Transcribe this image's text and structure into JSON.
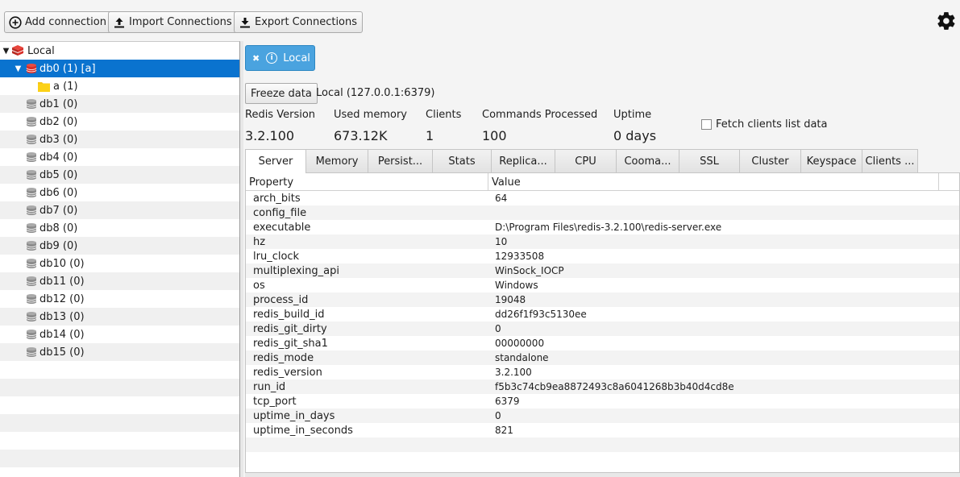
{
  "toolbar": {
    "add_connection": "Add connection",
    "import_connections": "Import Connections",
    "export_connections": "Export Connections"
  },
  "tree": {
    "root": "Local",
    "databases": [
      {
        "label": "db0 (1) [a]",
        "expanded": true,
        "selected": true
      },
      {
        "label": "db1 (0)"
      },
      {
        "label": "db2 (0)"
      },
      {
        "label": "db3 (0)"
      },
      {
        "label": "db4 (0)"
      },
      {
        "label": "db5 (0)"
      },
      {
        "label": "db6 (0)"
      },
      {
        "label": "db7 (0)"
      },
      {
        "label": "db8 (0)"
      },
      {
        "label": "db9 (0)"
      },
      {
        "label": "db10 (0)"
      },
      {
        "label": "db11 (0)"
      },
      {
        "label": "db12 (0)"
      },
      {
        "label": "db13 (0)"
      },
      {
        "label": "db14 (0)"
      },
      {
        "label": "db15 (0)"
      }
    ],
    "child_key": "a (1)"
  },
  "info_tab": {
    "label": "Local"
  },
  "freeze_button": "Freeze data",
  "connection": "Local (127.0.0.1:6379)",
  "stats": {
    "redis_version_label": "Redis Version",
    "redis_version": "3.2.100",
    "used_memory_label": "Used memory",
    "used_memory": "673.12K",
    "clients_label": "Clients",
    "clients": "1",
    "commands_label": "Commands Processed",
    "commands": "100",
    "uptime_label": "Uptime",
    "uptime": "0 days"
  },
  "fetch_clients": "Fetch clients list data",
  "tabs": [
    "Server",
    "Memory",
    "Persist...",
    "Stats",
    "Replica...",
    "CPU",
    "Cooma...",
    "SSL",
    "Cluster",
    "Keyspace",
    "Clients ..."
  ],
  "table": {
    "headers": [
      "Property",
      "Value"
    ],
    "rows": [
      [
        "arch_bits",
        "64"
      ],
      [
        "config_file",
        ""
      ],
      [
        "executable",
        "D:\\Program Files\\redis-3.2.100\\redis-server.exe"
      ],
      [
        "hz",
        "10"
      ],
      [
        "lru_clock",
        "12933508"
      ],
      [
        "multiplexing_api",
        "WinSock_IOCP"
      ],
      [
        "os",
        "Windows"
      ],
      [
        "process_id",
        "19048"
      ],
      [
        "redis_build_id",
        "dd26f1f93c5130ee"
      ],
      [
        "redis_git_dirty",
        "0"
      ],
      [
        "redis_git_sha1",
        "00000000"
      ],
      [
        "redis_mode",
        "standalone"
      ],
      [
        "redis_version",
        "3.2.100"
      ],
      [
        "run_id",
        "f5b3c74cb9ea8872493c8a6041268b3b40d4cd8e"
      ],
      [
        "tcp_port",
        "6379"
      ],
      [
        "uptime_in_days",
        "0"
      ],
      [
        "uptime_in_seconds",
        "821"
      ]
    ]
  },
  "colors": {
    "accent": "#0a73cf",
    "tab_blue": "#4aa3df",
    "redis_red": "#d8302a"
  }
}
